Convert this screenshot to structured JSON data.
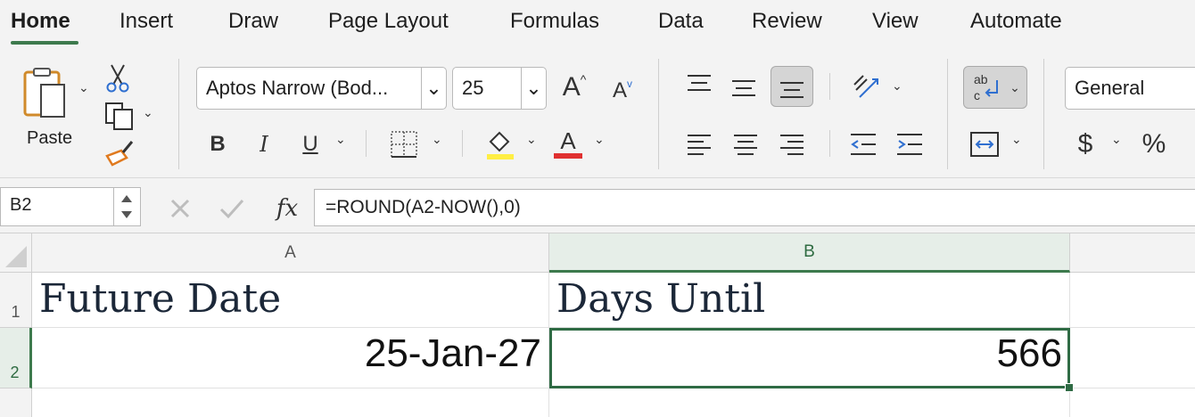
{
  "ribbon_tabs": [
    "Home",
    "Insert",
    "Draw",
    "Page Layout",
    "Formulas",
    "Data",
    "Review",
    "View",
    "Automate"
  ],
  "clipboard": {
    "paste_label": "Paste"
  },
  "font": {
    "family": "Aptos Narrow (Bod...",
    "size": "25",
    "bold": "B",
    "italic": "I",
    "underline": "U",
    "font_color_glyph": "A",
    "grow_glyph": "A",
    "shrink_glyph": "A"
  },
  "number": {
    "format": "General",
    "currency_symbol": "$",
    "percent_symbol": "%"
  },
  "colors": {
    "accent": "#3d7a4d",
    "fill_highlight": "#ffee44",
    "font_color": "#e03030"
  },
  "formula_bar": {
    "name_box": "B2",
    "fx_label": "fx",
    "formula": "=ROUND(A2-NOW(),0)"
  },
  "sheet": {
    "columns": [
      "A",
      "B"
    ],
    "rows": [
      "1",
      "2"
    ],
    "cells": {
      "A1": "Future Date",
      "B1": "Days Until",
      "A2": "25-Jan-27",
      "B2": "566"
    },
    "selected_cell": "B2"
  }
}
